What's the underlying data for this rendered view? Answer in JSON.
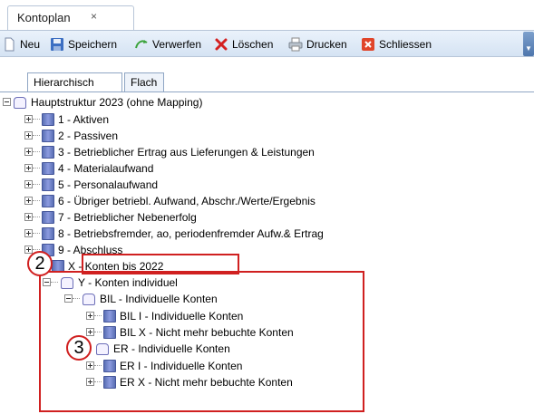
{
  "doc_tab": {
    "label": "Kontoplan",
    "close": "×"
  },
  "toolbar": {
    "new": "Neu",
    "save": "Speichern",
    "discard": "Verwerfen",
    "delete": "Löschen",
    "print": "Drucken",
    "close": "Schliessen",
    "icons": [
      "new-document-icon",
      "save-icon",
      "discard-icon",
      "delete-icon",
      "print-icon",
      "close-icon"
    ]
  },
  "view_tabs": [
    "Hierarchisch",
    "Flach"
  ],
  "tree": {
    "root": "Hauptstruktur 2023 (ohne Mapping)",
    "groups": [
      "1 - Aktiven",
      "2 - Passiven",
      "3 - Betrieblicher Ertrag aus Lieferungen & Leistungen",
      "4 - Materialaufwand",
      "5 - Personalaufwand",
      "6 - Übriger betriebl. Aufwand, Abschr./Werte/Ergebnis",
      "7 - Betrieblicher Nebenerfolg",
      "8 - Betriebsfremder, ao, periodenfremder Aufw.& Ertrag",
      "9 - Abschluss",
      "X - Konten bis 2022"
    ],
    "individual": {
      "label": "Y - Konten individuel",
      "bil": {
        "label": "BIL - Individuelle Konten",
        "children": [
          "BIL I - Individuelle Konten",
          "BIL X - Nicht mehr bebuchte Konten"
        ]
      },
      "er": {
        "label": "ER - Individuelle Konten",
        "children": [
          "ER I - Individuelle Konten",
          "ER X - Nicht mehr bebuchte Konten"
        ]
      }
    }
  },
  "annotations": {
    "marker_2": "2",
    "marker_3": "3",
    "color": "#d02020"
  }
}
